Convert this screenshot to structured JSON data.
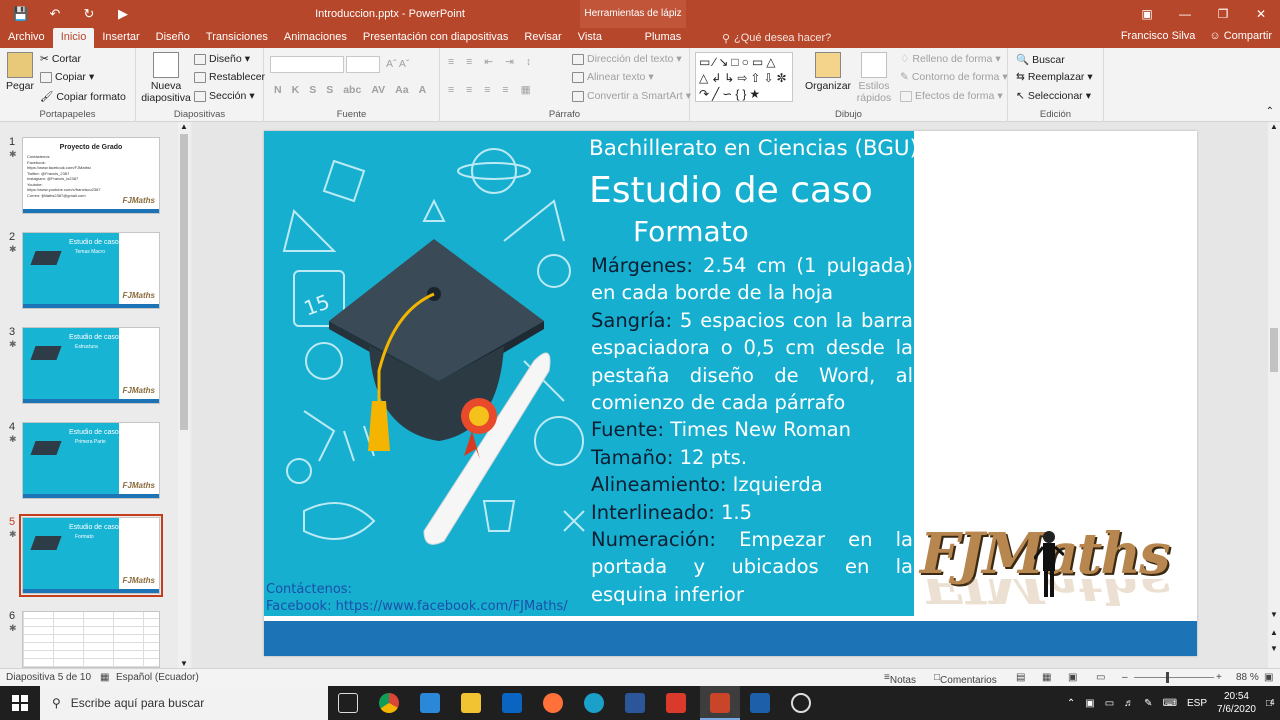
{
  "app": {
    "file_title": "Introduccion.pptx - PowerPoint",
    "context_tools": "Herramientas de lápiz",
    "user": "Francisco Silva",
    "share": "Compartir",
    "tell_me": "¿Qué desea hacer?"
  },
  "tabs": [
    "Archivo",
    "Inicio",
    "Insertar",
    "Diseño",
    "Transiciones",
    "Animaciones",
    "Presentación con diapositivas",
    "Revisar",
    "Vista",
    "Plumas"
  ],
  "ribbon": {
    "clipboard": {
      "paste": "Pegar",
      "cut": "Cortar",
      "copy": "Copiar",
      "format_painter": "Copiar formato",
      "label": "Portapapeles"
    },
    "slides": {
      "new_slide": "Nueva diapositiva",
      "layout": "Diseño",
      "reset": "Restablecer",
      "section": "Sección",
      "label": "Diapositivas"
    },
    "font": {
      "label": "Fuente",
      "bold": "N",
      "italic": "K",
      "underline": "S",
      "shadow": "S",
      "strike": "abc",
      "spacing": "AV",
      "case": "Aa",
      "color": "A"
    },
    "paragraph": {
      "text_direction": "Dirección del texto",
      "align_text": "Alinear texto",
      "smartart": "Convertir a SmartArt",
      "label": "Párrafo"
    },
    "drawing": {
      "arrange": "Organizar",
      "quick_styles": "Estilos rápidos",
      "fill": "Relleno de forma",
      "outline": "Contorno de forma",
      "effects": "Efectos de forma",
      "label": "Dibujo"
    },
    "editing": {
      "find": "Buscar",
      "replace": "Reemplazar",
      "select": "Seleccionar",
      "label": "Edición"
    }
  },
  "thumbnails": [
    {
      "num": "1",
      "title": "Proyecto de Grado",
      "lines": [
        "Contáctenos",
        "Facebook:",
        "https://www.facebook.com/FJMaths/",
        "Twitter: @Francis_2387",
        "Instagram: @Francis_is2387",
        "Youtube:",
        "https://www.youtube.com/c/francisco2387",
        "Correo: fjMaths2387@gmail.com"
      ]
    },
    {
      "num": "2",
      "title": "Estudio de caso",
      "sub": "Temas Macro"
    },
    {
      "num": "3",
      "title": "Estudio de caso",
      "sub": "Estructura"
    },
    {
      "num": "4",
      "title": "Estudio de caso",
      "sub": "Primera Parte"
    },
    {
      "num": "5",
      "title": "Estudio de caso",
      "sub": "Formato"
    },
    {
      "num": "6",
      "title": "",
      "sub": ""
    }
  ],
  "slide": {
    "header": "Bachillerato en Ciencias (BGU)",
    "title": "Estudio de caso",
    "subtitle": "Formato",
    "items": [
      {
        "key": "Márgenes:",
        "value": " 2.54 cm (1 pulgada) en cada borde de la hoja"
      },
      {
        "key": "Sangría:",
        "value": " 5 espacios con la barra espaciadora o 0,5 cm desde la pestaña diseño de Word, al comienzo de cada párrafo"
      },
      {
        "key": "Fuente:",
        "value": " Times New Roman"
      },
      {
        "key": "Tamaño:",
        "value": " 12 pts."
      },
      {
        "key": "Alineamiento:",
        "value": " Izquierda"
      },
      {
        "key": "Interlineado:",
        "value": " 1.5"
      },
      {
        "key": "Numeración:",
        "value": " Empezar en la portada y ubicados en la esquina inferior"
      }
    ],
    "contact_label": "Contáctenos:",
    "contact_facebook": "Facebook: https://www.facebook.com/FJMaths/",
    "logo": "FJMaths",
    "board_number": "15"
  },
  "statusbar": {
    "slide": "Diapositiva 5 de 10",
    "language": "Español (Ecuador)",
    "notes": "Notas",
    "comments": "Comentarios",
    "zoom": "88 %"
  },
  "taskbar": {
    "search": "Escribe aquí para buscar",
    "lang": "ESP",
    "time": "20:54",
    "date": "7/6/2020",
    "notif": "4"
  },
  "colors": {
    "accent": "#b7472a",
    "slide_bg": "#16afd0",
    "bar": "#1c73b6",
    "key_text": "#0b1f33"
  }
}
